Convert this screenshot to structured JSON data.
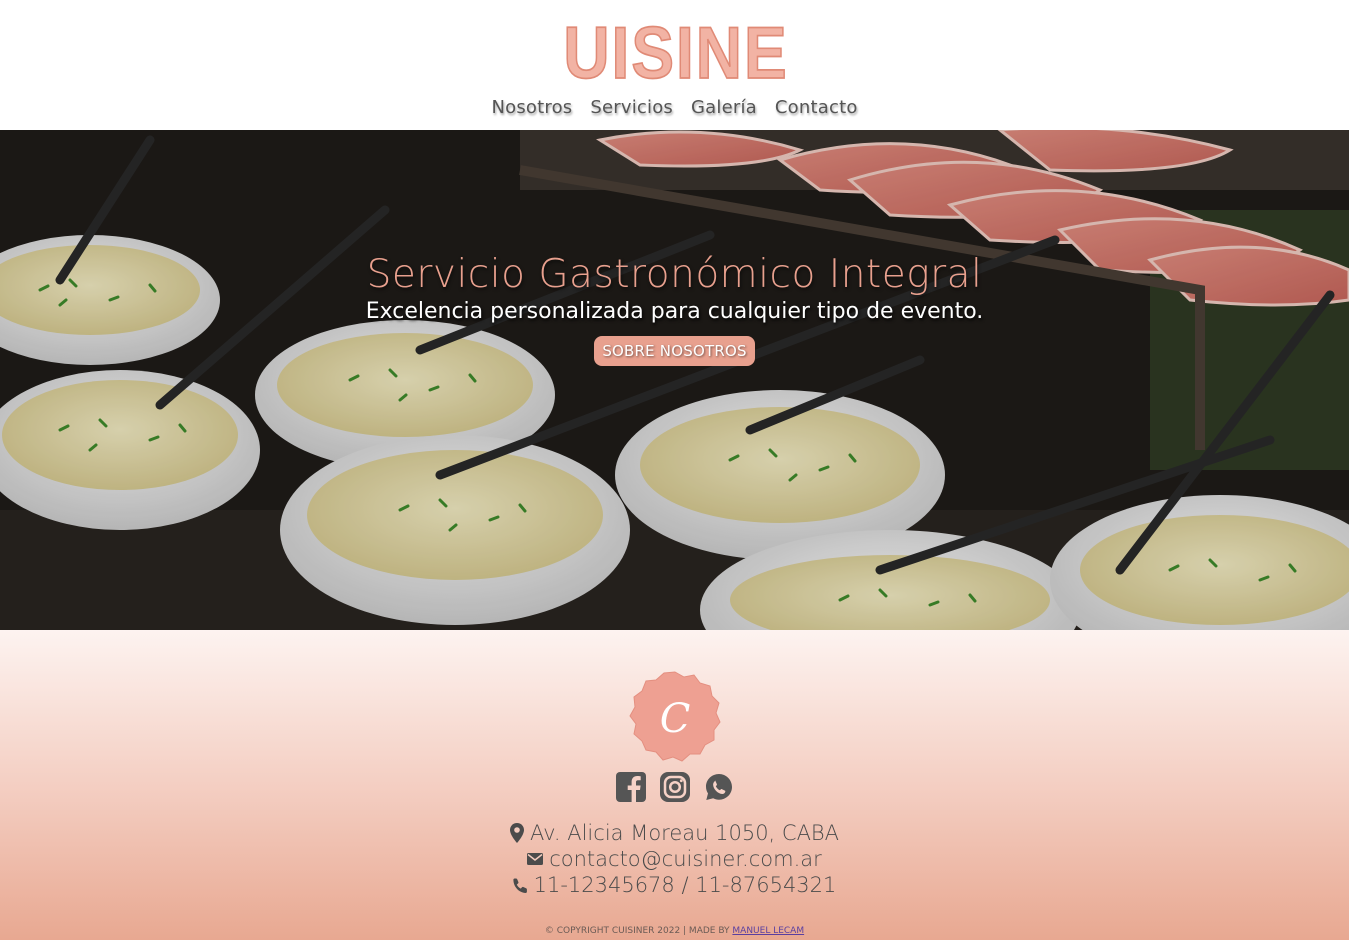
{
  "header": {
    "logo_text": "CUISINER",
    "nav": [
      {
        "label": "Nosotros"
      },
      {
        "label": "Servicios"
      },
      {
        "label": "Galería"
      },
      {
        "label": "Contacto"
      }
    ]
  },
  "hero": {
    "title": "Servicio Gastronómico Integral",
    "subtitle": "Excelencia personalizada para cualquier tipo de evento.",
    "button": "SOBRE NOSOTROS"
  },
  "footer": {
    "logo_letter": "C",
    "socials": [
      "facebook-icon",
      "instagram-icon",
      "whatsapp-icon"
    ],
    "address": "Av. Alicia Moreau 1050, CABA",
    "email": "contacto@cuisiner.com.ar",
    "phone": "11-12345678 / 11-87654321",
    "copyright": "© COPYRIGHT CUISINER 2022 | MADE BY",
    "author": "MANUEL LECAM"
  },
  "colors": {
    "brand": "#e8a08e",
    "text": "#4b4b4b"
  }
}
